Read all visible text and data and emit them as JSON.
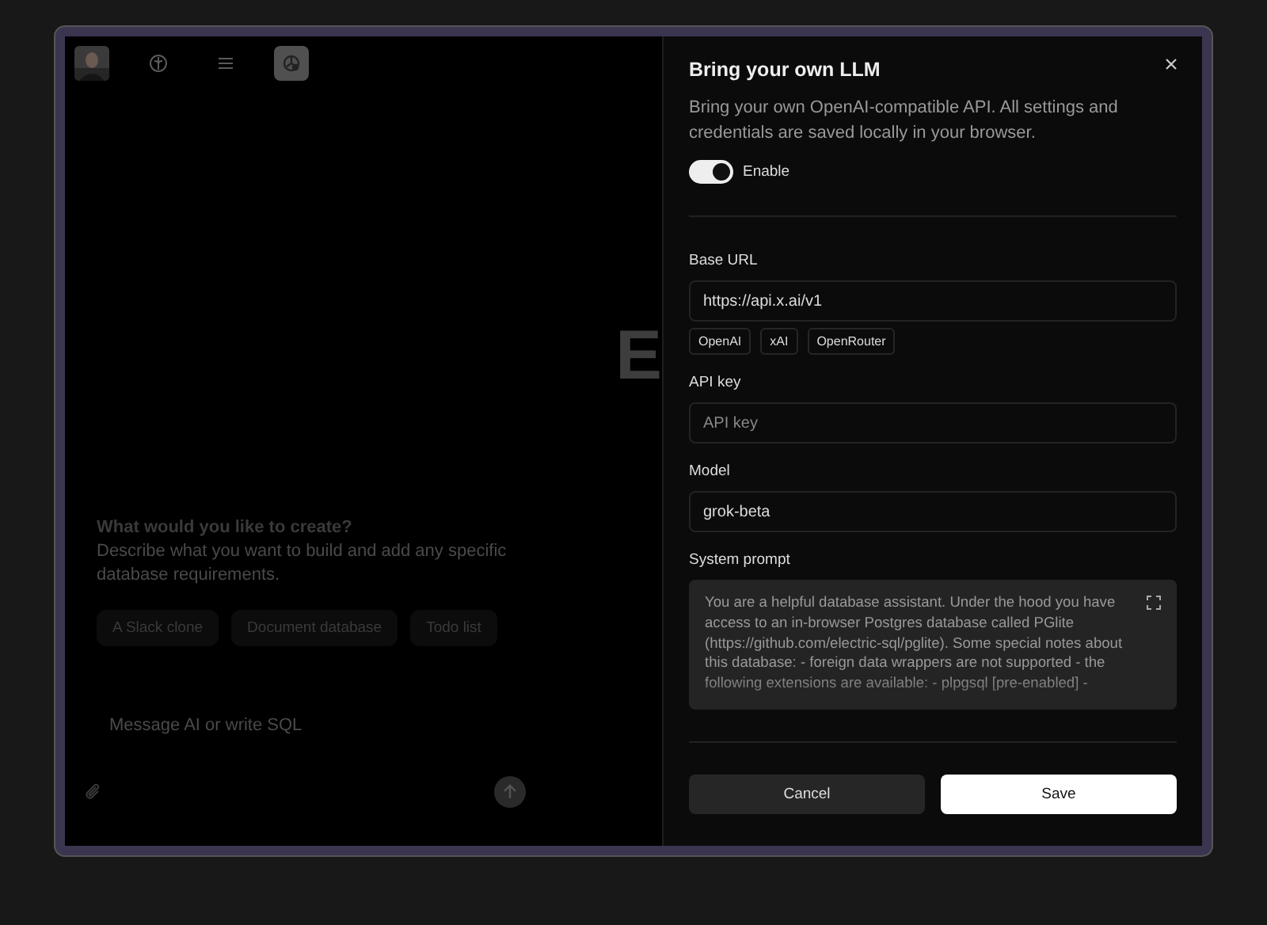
{
  "toolbar": [
    {
      "kind": "avatar"
    },
    {
      "kind": "brain",
      "selected": false
    },
    {
      "kind": "menu",
      "selected": false
    },
    {
      "kind": "network",
      "selected": true
    }
  ],
  "canvas": {
    "heading": "E"
  },
  "chat": {
    "title": "What would you like to create?",
    "description": "Describe what you want to build and add any specific database requirements.",
    "suggestions": [
      "A Slack clone",
      "Document database",
      "Todo list"
    ],
    "message": {
      "placeholder": "Message AI or write SQL"
    }
  },
  "dialog": {
    "title": "Bring your own LLM",
    "description": "Bring your own OpenAI-compatible API. All settings and credentials are saved locally in your browser.",
    "enable": {
      "label": "Enable",
      "on": true
    },
    "base_url": {
      "label": "Base URL",
      "value": "https://api.x.ai/v1",
      "presets": [
        "OpenAI",
        "xAI",
        "OpenRouter"
      ]
    },
    "api_key": {
      "label": "API key",
      "placeholder": "API key"
    },
    "model": {
      "label": "Model",
      "value": "grok-beta"
    },
    "system_prompt": {
      "label": "System prompt",
      "value": "You are a helpful database assistant. Under the hood you have access to an in-browser Postgres database called PGlite (https://github.com/electric-sql/pglite). Some special notes about this database: - foreign data wrappers are not supported - the following extensions are available: - plpgsql [pre-enabled] -"
    },
    "buttons": [
      {
        "label": "Cancel",
        "kind": "secondary"
      },
      {
        "label": "Save",
        "kind": "primary"
      }
    ]
  }
}
